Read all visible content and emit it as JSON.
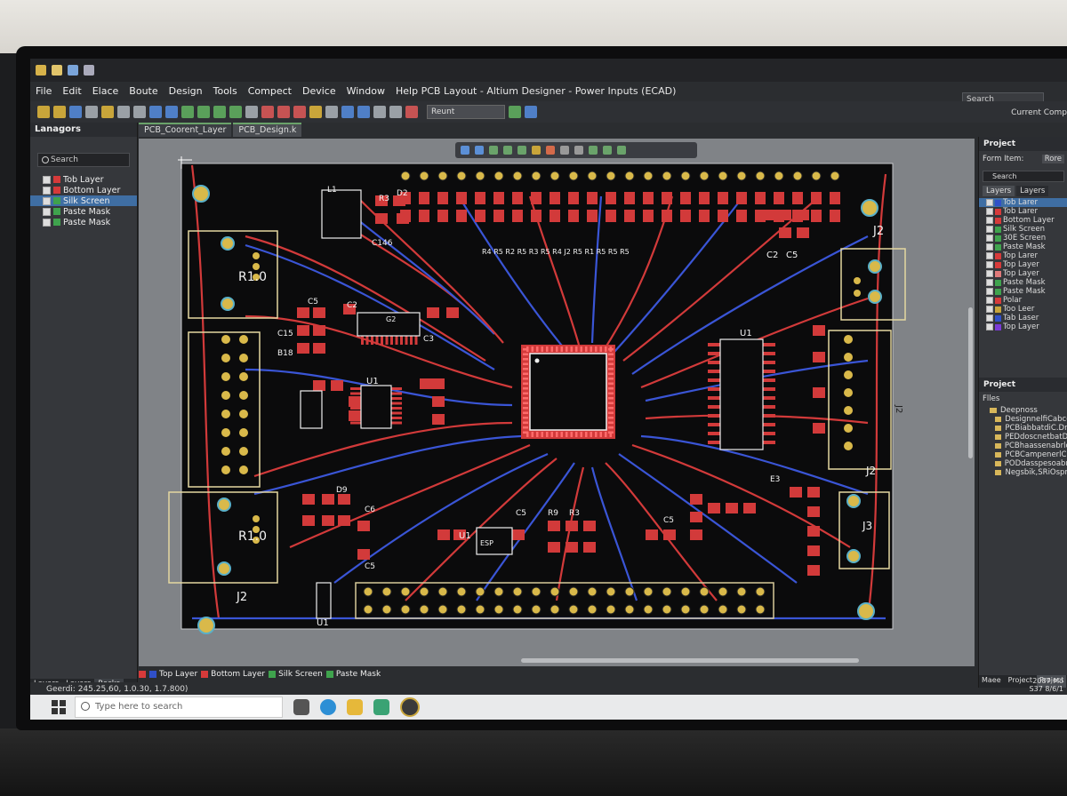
{
  "window": {
    "title": "PCB Layout - Altium Designer - Power Inputs (ECAD)",
    "search_placeholder": "Search",
    "current_comp": "Current Comp"
  },
  "menu": [
    "File",
    "Edit",
    "Elace",
    "Boute",
    "Design",
    "Tools",
    "Compect",
    "Device",
    "Window",
    "Help"
  ],
  "toolbar": {
    "combo_value": "Reunt"
  },
  "left_panel": {
    "title": "Lanagors",
    "search": "Search",
    "layers": [
      {
        "label": "Tob Layer",
        "color": "#d63a3a",
        "selected": false
      },
      {
        "label": "Bottom Layer",
        "color": "#d63a3a",
        "selected": false
      },
      {
        "label": "Silk Screen",
        "color": "#3fa34d",
        "selected": true
      },
      {
        "label": "Paste Mask",
        "color": "#3fa34d",
        "selected": false
      },
      {
        "label": "Paste Mask",
        "color": "#3fa34d",
        "selected": false
      }
    ],
    "tabs": [
      "Layers",
      "Layers",
      "Recks"
    ]
  },
  "doc_tabs": [
    "PCB_Coorent_Layer",
    "PCB_Design.k"
  ],
  "board_labels": {
    "j2_top": "J2",
    "j2_right": "J2",
    "j2_bottom_right": "J2",
    "j2_bottom_left": "J2",
    "j3": "J3",
    "r10_top": "R1.0",
    "r10_bottom": "R1.0",
    "u1_top": "U1",
    "u1_left": "U1",
    "u1_right": "U1",
    "u1_bottom": "U1",
    "u1_mid": "U1",
    "c5a": "C5",
    "c5b": "C5",
    "c5c": "C5",
    "c5d": "C5",
    "c2": "C2",
    "c3": "C3",
    "c15": "C15",
    "b18": "B18",
    "r3": "R3",
    "r3b": "R3",
    "r9": "R9",
    "d2": "D2",
    "d9": "D9",
    "e3": "E3",
    "u2": "U2",
    "c2b": "C2",
    "c5e": "C5",
    "c6": "C6",
    "c46": "C146",
    "g2": "G2",
    "l1": "L1",
    "esp": "ESP",
    "top_row": "R4 R5 R2 R5 R3 R5 R4 J2 R5 R1 R5 R5 R5"
  },
  "layer_bar": [
    "Top Layer",
    "Bottom Layer",
    "Silk Screen",
    "Paste Mask"
  ],
  "status": "Geerdi: 245.25,60, 1.0.30, 1.7.800)",
  "right_panel": {
    "title": "Project",
    "form_item_label": "Form Item:",
    "form_item_value": "Rore",
    "search": "Search",
    "tabs": [
      "Layers",
      "Layers"
    ],
    "layers": [
      {
        "label": "Tob Larer",
        "color": "#3050c8",
        "selected": true
      },
      {
        "label": "Tob Larer",
        "color": "#d63a3a",
        "selected": false
      },
      {
        "label": "Bottom Layer",
        "color": "#d63a3a",
        "selected": false
      },
      {
        "label": "Silk Screen",
        "color": "#3fa34d",
        "selected": false
      },
      {
        "label": "30E Screen",
        "color": "#3fa34d",
        "selected": false
      },
      {
        "label": "Paste Mask",
        "color": "#3fa34d",
        "selected": false
      },
      {
        "label": "Top Larer",
        "color": "#d63a3a",
        "selected": false
      },
      {
        "label": "Top Layer",
        "color": "#d63a3a",
        "selected": false
      },
      {
        "label": "Top Layer",
        "color": "#e07a7a",
        "selected": false
      },
      {
        "label": "Paste Mask",
        "color": "#3fa34d",
        "selected": false
      },
      {
        "label": "Paste Mask",
        "color": "#3fa34d",
        "selected": false
      },
      {
        "label": "Polar",
        "color": "#d63a3a",
        "selected": false
      },
      {
        "label": "Too Leer",
        "color": "#c8a53a",
        "selected": false
      },
      {
        "label": "Tab Laser",
        "color": "#3050c8",
        "selected": false
      },
      {
        "label": "Top Layer",
        "color": "#7a3ad6",
        "selected": false
      }
    ],
    "project_title": "Project",
    "files_label": "Flles",
    "files": [
      "Deepnoss",
      "DesignnelfiCabcor",
      "PCBiabbatdiC.DnF",
      "PEDdoscnetbatDnh",
      "PCBhaassenabrlcch",
      "PCBCampenerlC.C",
      "PODdasspesoabrGh",
      "Negsbik,SRiOspre"
    ],
    "bottom_tabs": [
      "Maee",
      "Project",
      "Project"
    ]
  },
  "taskbar": {
    "search_placeholder": "Type here to search",
    "tray_time": "2087 Mo",
    "tray_date": "S37 8/6/1"
  }
}
